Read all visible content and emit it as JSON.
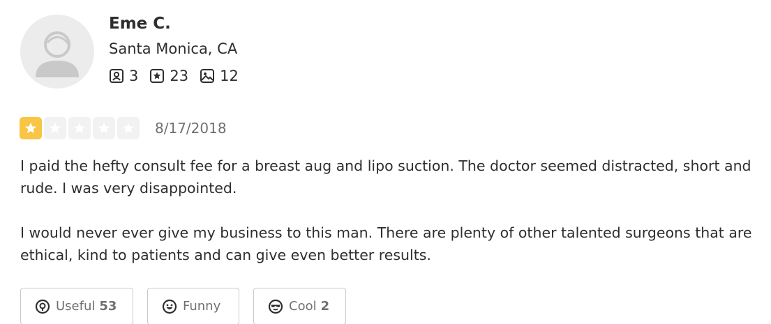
{
  "user": {
    "name": "Eme C.",
    "location": "Santa Monica, CA",
    "stats": {
      "friends": "3",
      "reviews": "23",
      "photos": "12"
    }
  },
  "review": {
    "rating": 1,
    "rating_max": 5,
    "date": "8/17/2018",
    "paragraphs": [
      "I paid the hefty consult fee for a breast aug and lipo suction.  The doctor seemed distracted, short and rude.  I was very disappointed.",
      "I would never ever give my business to this man.  There are plenty of other talented surgeons that are ethical, kind to patients and can give even better results."
    ]
  },
  "reactions": {
    "useful": {
      "label": "Useful",
      "count": "53"
    },
    "funny": {
      "label": "Funny",
      "count": ""
    },
    "cool": {
      "label": "Cool",
      "count": "2"
    }
  },
  "colors": {
    "star_filled": "#f9c545",
    "star_empty": "#f2f2f2",
    "text": "#2d2e2f",
    "muted": "#6e7072"
  },
  "icons": {
    "avatar": "user-placeholder-icon",
    "friends": "friends-icon",
    "reviews": "review-star-icon",
    "photos": "photo-icon",
    "useful": "lightbulb-icon",
    "funny": "smile-icon",
    "cool": "sunglasses-icon"
  }
}
